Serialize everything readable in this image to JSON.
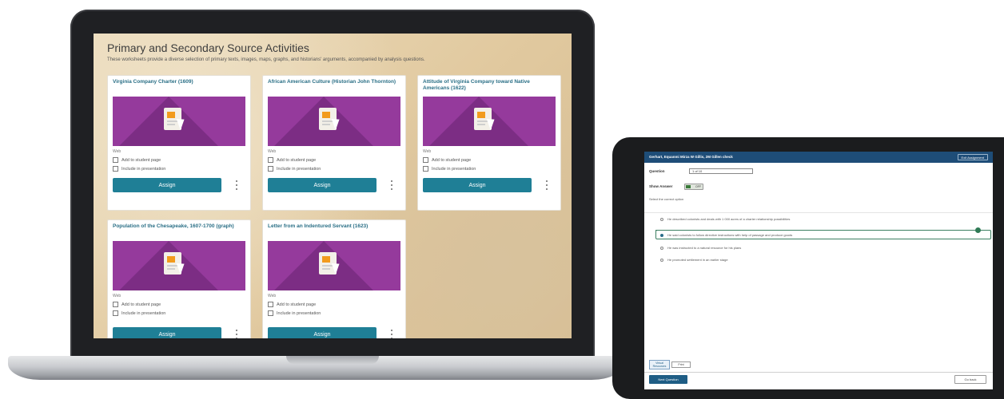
{
  "laptop": {
    "page_title": "Primary and Secondary Source Activities",
    "page_subtitle": "These worksheets provide a diverse selection of primary texts, images, maps, graphs, and historians' arguments, accompanied by analysis questions.",
    "cards": [
      {
        "title": "Virginia Company Charter (1609)",
        "meta": "Web",
        "add_label": "Add to student page",
        "include_label": "Include in presentation",
        "assign_label": "Assign"
      },
      {
        "title": "African American Culture (Historian John Thornton)",
        "meta": "Web",
        "add_label": "Add to student page",
        "include_label": "Include in presentation",
        "assign_label": "Assign"
      },
      {
        "title": "Attitude of Virginia Company toward Native Americans (1622)",
        "meta": "Web",
        "add_label": "Add to student page",
        "include_label": "Include in presentation",
        "assign_label": "Assign"
      },
      {
        "title": "Population of the Chesapeake, 1607-1700 (graph)",
        "meta": "Web",
        "add_label": "Add to student page",
        "include_label": "Include in presentation",
        "assign_label": "Assign"
      },
      {
        "title": "Letter from an Indentured Servant (1623)",
        "meta": "Web",
        "add_label": "Add to student page",
        "include_label": "Include in presentation",
        "assign_label": "Assign"
      }
    ],
    "thumb_color": "#953a9c",
    "assign_color": "#1f7f96",
    "icons": {
      "document": "document-icon",
      "cursor": "cursor-icon",
      "more": "kebab-icon"
    }
  },
  "tablet": {
    "topbar_title": "Gerhart, Equanmi Mirza W Gillis, 2M Gillen check",
    "topbar_button": "Exit Assignment",
    "question_label": "Question",
    "question_select": "1 of 10",
    "show_answer_label": "Show Answer",
    "toggle_label": "OFF",
    "prompt": "Select the correct option",
    "options": [
      {
        "text": "He described colonists and deals with 1 000 acres of a charter relationship possibilities",
        "selected": false
      },
      {
        "text": "He said colonists to follow directive instructions with help of passage and produce goods",
        "selected": true
      },
      {
        "text": "He was instructed to a natural resource for his plans",
        "selected": false
      },
      {
        "text": "He promoted settlement in an earlier stage",
        "selected": false
      }
    ],
    "tool_label": "Virtual Resources",
    "tool2_label": "Print",
    "primary_button": "Next Question",
    "secondary_button": "Go back",
    "accent_color": "#1e4d78"
  }
}
